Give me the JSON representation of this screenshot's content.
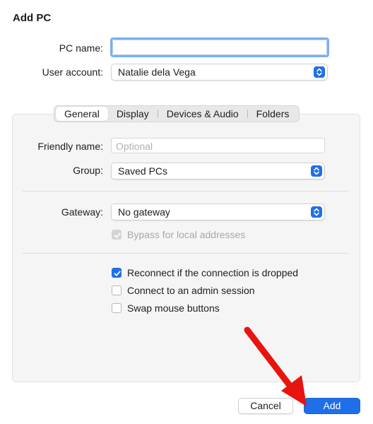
{
  "dialog": {
    "title": "Add PC"
  },
  "pc_name": {
    "label": "PC name:",
    "value": ""
  },
  "user_account": {
    "label": "User account:",
    "value": "Natalie dela Vega"
  },
  "tabs": [
    {
      "label": "General",
      "selected": true
    },
    {
      "label": "Display",
      "selected": false
    },
    {
      "label": "Devices & Audio",
      "selected": false
    },
    {
      "label": "Folders",
      "selected": false
    }
  ],
  "general": {
    "friendly_name": {
      "label": "Friendly name:",
      "placeholder": "Optional"
    },
    "group": {
      "label": "Group:",
      "value": "Saved PCs"
    },
    "gateway": {
      "label": "Gateway:",
      "value": "No gateway"
    },
    "bypass": {
      "label": "Bypass for local addresses",
      "checked": true,
      "disabled": true
    },
    "reconnect": {
      "label": "Reconnect if the connection is dropped",
      "checked": true
    },
    "admin_session": {
      "label": "Connect to an admin session",
      "checked": false
    },
    "swap_mouse": {
      "label": "Swap mouse buttons",
      "checked": false
    }
  },
  "buttons": {
    "cancel": "Cancel",
    "add": "Add"
  },
  "colors": {
    "accent": "#1f6fe8",
    "annotation_arrow": "#e8140f"
  },
  "icons": {
    "popup_stepper": "up-down-chevron-icon",
    "checkbox": "checkmark-icon",
    "annotation": "red-arrow-icon"
  }
}
